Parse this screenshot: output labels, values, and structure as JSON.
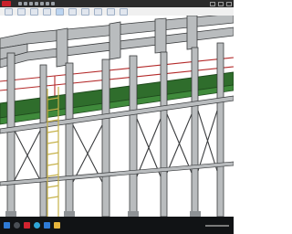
{
  "app": {
    "title": "",
    "menus": []
  },
  "toolbar": {
    "buttons": [
      {
        "icon": "view-orientation-icon"
      },
      {
        "icon": "zoom-fit-icon"
      },
      {
        "icon": "zoom-area-icon"
      },
      {
        "icon": "previous-view-icon"
      },
      {
        "icon": "section-view-icon"
      },
      {
        "icon": "display-style-icon"
      },
      {
        "icon": "hide-show-icon"
      },
      {
        "icon": "appearance-icon"
      },
      {
        "icon": "scene-icon"
      },
      {
        "icon": "view-settings-icon"
      }
    ]
  },
  "model": {
    "description_colors": {
      "steel": "#b9bcbe",
      "edge": "#3a3c3e",
      "deck": "#2f6d2c",
      "deck_edge": "#1f4a1d",
      "railing": "#b42a2a",
      "ladder": "#c6b24a"
    }
  },
  "status_bar": {
    "text": ""
  },
  "taskbar": {
    "apps": [
      "windows-icon",
      "search-icon",
      "solidworks-icon",
      "edge-icon",
      "mail-icon",
      "folder-icon"
    ]
  }
}
